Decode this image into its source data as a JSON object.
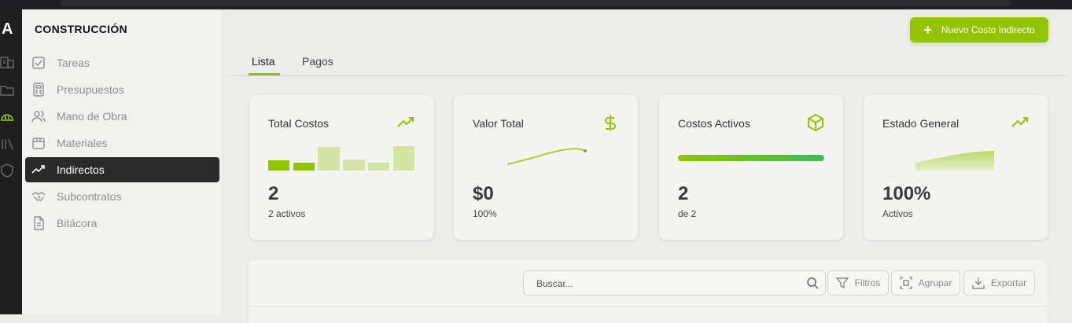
{
  "app": {
    "logo_letter": "A"
  },
  "sidebar": {
    "title": "CONSTRUCCIÓN",
    "items": [
      {
        "label": "Tareas",
        "icon": "checkbox-icon",
        "active": false
      },
      {
        "label": "Presupuestos",
        "icon": "calculator-icon",
        "active": false
      },
      {
        "label": "Mano de Obra",
        "icon": "users-icon",
        "active": false
      },
      {
        "label": "Materiales",
        "icon": "package-icon",
        "active": false
      },
      {
        "label": "Indirectos",
        "icon": "trending-up-icon",
        "active": true
      },
      {
        "label": "Subcontratos",
        "icon": "handshake-icon",
        "active": false
      },
      {
        "label": "Bitácora",
        "icon": "document-icon",
        "active": false
      }
    ]
  },
  "header": {
    "primary_button": "Nuevo Costo Indirecto"
  },
  "tabs": [
    {
      "label": "Lista",
      "active": true
    },
    {
      "label": "Pagos",
      "active": false
    }
  ],
  "cards": [
    {
      "title": "Total Costos",
      "value": "2",
      "sub": "2 activos",
      "icon": "trending-up-icon",
      "chart": "mini-bars"
    },
    {
      "title": "Valor Total",
      "value": "$0",
      "sub": "100%",
      "icon": "dollar-icon",
      "chart": "mini-line"
    },
    {
      "title": "Costos Activos",
      "value": "2",
      "sub": "de 2",
      "icon": "box-icon",
      "chart": "progress",
      "progress": 1.0
    },
    {
      "title": "Estado General",
      "value": "100%",
      "sub": "Activos",
      "icon": "trending-up-icon",
      "chart": "mini-area"
    }
  ],
  "toolbar": {
    "search_placeholder": "Buscar...",
    "filters_label": "Filtros",
    "group_label": "Agrupar",
    "export_label": "Exportar"
  },
  "colors": {
    "accent": "#92c400",
    "accent_light": "#d3e5a4",
    "dark": "#2a2a2a",
    "progress_end": "#3dbb5a"
  }
}
